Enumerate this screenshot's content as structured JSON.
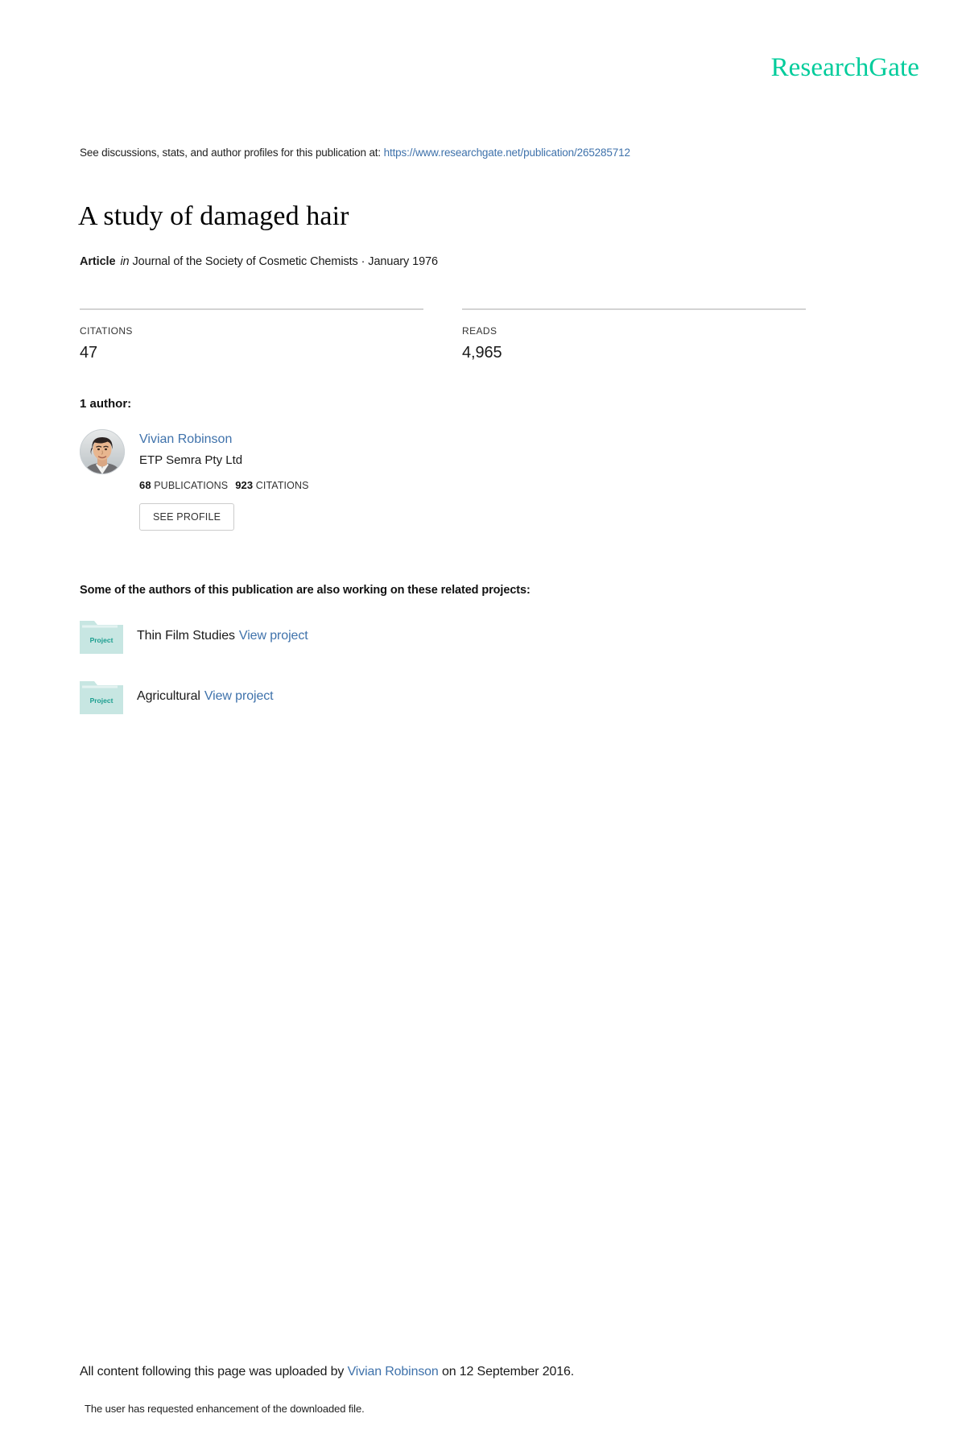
{
  "brand": {
    "name": "ResearchGate",
    "color": "#00cc9b"
  },
  "header": {
    "discussion_prefix": "See discussions, stats, and author profiles for this publication at: ",
    "publication_url": "https://www.researchgate.net/publication/265285712"
  },
  "publication": {
    "title": "A study of damaged hair",
    "type_label": "Article",
    "in_word": "in",
    "source": "Journal of the Society of Cosmetic Chemists · January 1976"
  },
  "stats": [
    {
      "caption": "CITATIONS",
      "value": "47"
    },
    {
      "caption": "READS",
      "value": "4,965"
    }
  ],
  "authors": {
    "heading": "1 author:",
    "list": [
      {
        "name": "Vivian Robinson",
        "affiliation": "ETP Semra Pty Ltd",
        "publications_count": "68",
        "publications_label": "PUBLICATIONS",
        "citations_count": "923",
        "citations_label": "CITATIONS",
        "profile_button": "SEE PROFILE",
        "avatar_icon": "author-photo-avatar"
      }
    ]
  },
  "projects": {
    "heading": "Some of the authors of this publication are also working on these related projects:",
    "folder_badge": "Project",
    "items": [
      {
        "name": "Thin Film Studies",
        "link_label": "View project",
        "icon": "project-folder-icon"
      },
      {
        "name": "Agricultural",
        "link_label": "View project",
        "icon": "project-folder-icon"
      }
    ]
  },
  "footer": {
    "upload_prefix": "All content following this page was uploaded by ",
    "uploader_name": "Vivian Robinson",
    "upload_suffix": " on 12 September 2016.",
    "enhancement_note": "The user has requested enhancement of the downloaded file."
  }
}
